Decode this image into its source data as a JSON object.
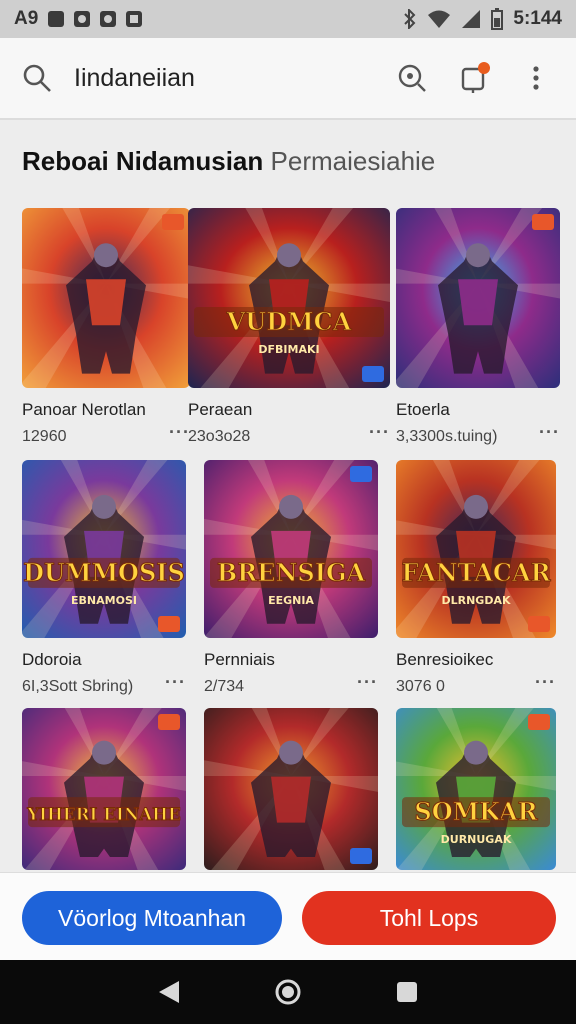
{
  "status_bar": {
    "left_text": "A9",
    "time": "5:144",
    "icons": [
      "message-icon",
      "circle-icon",
      "camera-icon",
      "image-icon",
      "bluetooth-icon",
      "wifi-icon",
      "signal-icon",
      "battery-icon"
    ]
  },
  "search": {
    "value": "Iindaneiian",
    "icons": [
      "search-icon",
      "lens-icon",
      "notifications-icon",
      "more-vertical-icon"
    ]
  },
  "section": {
    "title_strong": "Reboai Nidamusian",
    "title_light": "Permaiesiahie"
  },
  "games": [
    {
      "title": "Panoar Nerotlan",
      "meta": "12960",
      "colors": [
        "#f2a23a",
        "#d8432a",
        "#3b2a59"
      ]
    },
    {
      "title": "Peraean",
      "meta": "23o3o28",
      "logo": "VUDMCA",
      "sub": "DFBIMAKI",
      "colors": [
        "#1a2552",
        "#b8201e",
        "#f0c32e"
      ]
    },
    {
      "title": "Etoerla",
      "meta": "3,3300s.tuing)",
      "colors": [
        "#2a2f7a",
        "#8e2b8a",
        "#33b5f0"
      ]
    },
    {
      "title": "Ddoroia",
      "meta": "6I,3Sott Sbring)",
      "logo": "DUMMOSIS",
      "sub": "EBNAMOSI",
      "colors": [
        "#1e5fb0",
        "#7a3a9c",
        "#f3c030"
      ]
    },
    {
      "title": "Pernniais",
      "meta": "2/734",
      "logo": "BRENSIGA",
      "sub": "EEGNIA",
      "colors": [
        "#3a1d6b",
        "#c13a7a",
        "#f1b52c"
      ]
    },
    {
      "title": "Benresioikec",
      "meta": "3076 0",
      "logo": "FANTACAR",
      "sub": "DLRNGDAK",
      "colors": [
        "#f08b2a",
        "#b83222",
        "#3a2a5a"
      ]
    },
    {
      "title": "",
      "meta": "",
      "logo": "YIHERI EINAHE",
      "colors": [
        "#3b2a7a",
        "#b0337a",
        "#f4c23a"
      ]
    },
    {
      "title": "",
      "meta": "",
      "colors": [
        "#2a1d1d",
        "#b22a2a",
        "#f39a2c"
      ]
    },
    {
      "title": "",
      "meta": "",
      "logo": "SOMKAR",
      "sub": "DURNUGAK",
      "colors": [
        "#3a8ad8",
        "#5aa83a",
        "#f3c030"
      ]
    }
  ],
  "actions": {
    "primary_label": "Vöorlog Mtoanhan",
    "secondary_label": "Tohl Lops",
    "primary_color": "#1e63d9",
    "secondary_color": "#e2321f"
  },
  "nav": {
    "back": "back-icon",
    "home": "home-icon",
    "recents": "recents-icon"
  }
}
